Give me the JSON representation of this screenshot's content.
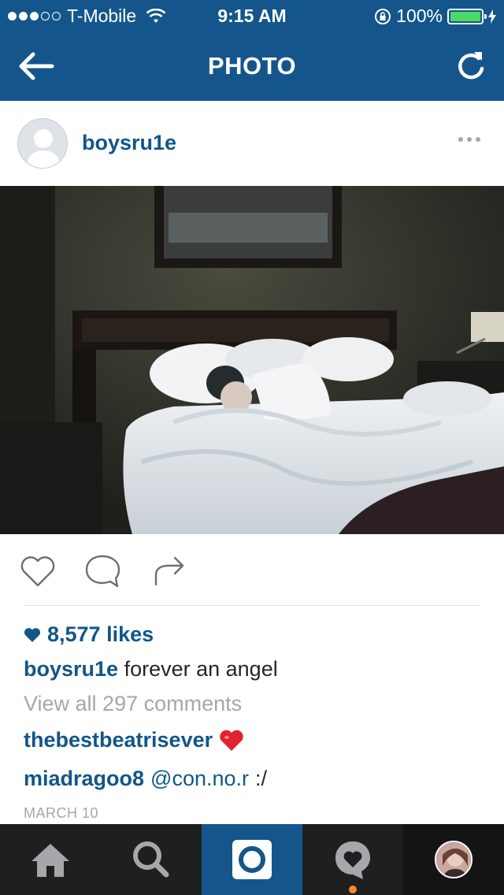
{
  "status_bar": {
    "carrier": "T-Mobile",
    "time": "9:15 AM",
    "battery": "100%",
    "signal_bars_filled": 3,
    "signal_bars_total": 5
  },
  "nav": {
    "title": "PHOTO",
    "back_icon": "arrow-left-icon",
    "refresh_icon": "refresh-icon"
  },
  "post": {
    "username": "boysru1e",
    "likes": "8,577 likes",
    "caption_user": "boysru1e",
    "caption_text": "forever an angel",
    "view_all": "View all 297 comments",
    "comments": [
      {
        "user": "thebestbeatrisever",
        "text": "",
        "emoji": "red-heart-emoji"
      },
      {
        "user": "miadragoo8",
        "mention": "@con.no.r",
        "text": ":/"
      }
    ],
    "date": "MARCH 10"
  },
  "tabbar": {
    "items": [
      "home",
      "search",
      "camera",
      "activity",
      "profile"
    ],
    "active": "camera"
  },
  "colors": {
    "brand": "#14568c",
    "link": "#125688",
    "muted": "#a5a7aa",
    "battery": "#4cd964",
    "notification": "#f5892c"
  }
}
